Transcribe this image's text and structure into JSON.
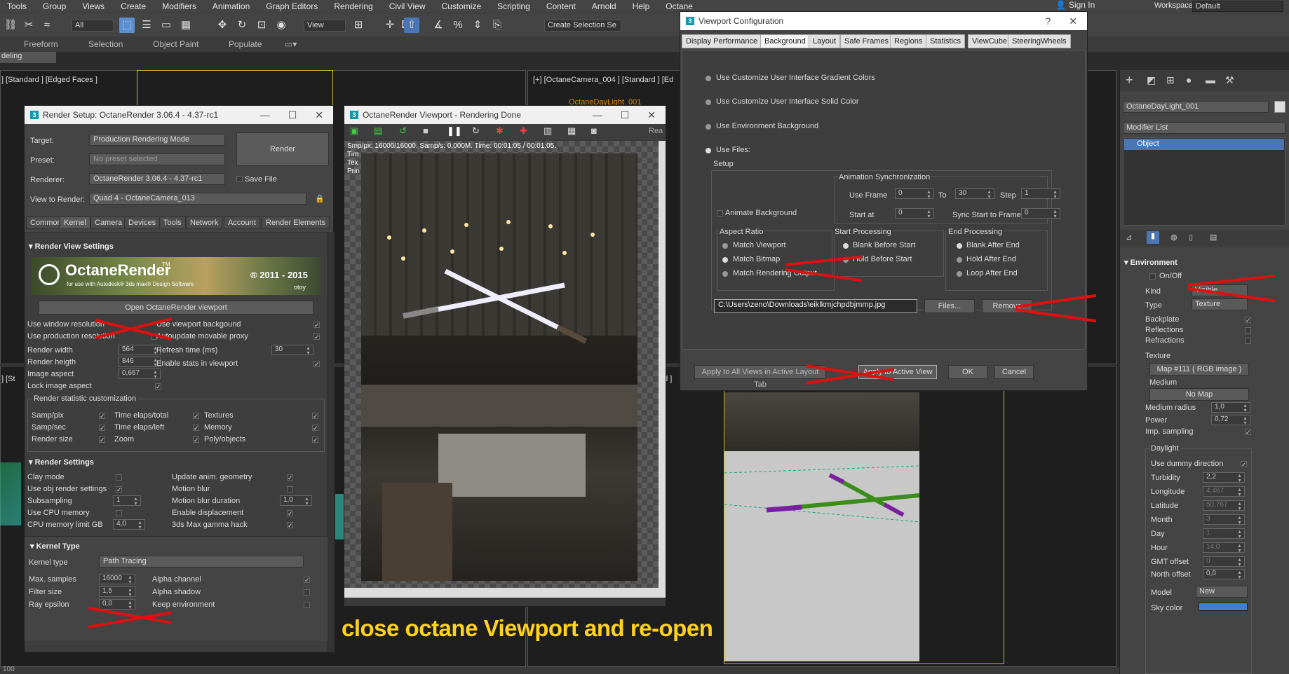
{
  "menubar": {
    "items": [
      "Tools",
      "Group",
      "Views",
      "Create",
      "Modifiers",
      "Animation",
      "Graph Editors",
      "Rendering",
      "Civil View",
      "Customize",
      "Scripting",
      "Content",
      "Arnold",
      "Help",
      "Octane"
    ],
    "sign_in": "Sign In",
    "workspaces_label": "Workspaces:",
    "workspaces_value": "Default"
  },
  "toolbar": {
    "filter_select": "All",
    "view_select": "View",
    "selection_set": "Create Selection Se"
  },
  "ribbon": {
    "items": [
      "Freeform",
      "Selection",
      "Object Paint",
      "Populate"
    ],
    "mode": "deling"
  },
  "viewports": {
    "top_left": "] [Standard ] [Edged Faces ]",
    "top_right": "[+] [OctaneCamera_004 ] [Standard ] [Ed",
    "top_right_obj": "OctaneDayLight_001",
    "bottom_left": "] [St",
    "bottom_right": "ed ]"
  },
  "render_setup": {
    "title": "Render Setup: OctaneRender 3.06.4 - 4.37-rc1",
    "target_label": "Target:",
    "target_value": "Production Rendering Mode",
    "preset_label": "Preset:",
    "preset_value": "No preset selected",
    "renderer_label": "Renderer:",
    "renderer_value": "OctaneRender 3.06.4 - 4.37-rc1",
    "save_file": "Save File",
    "view_label": "View to Render:",
    "view_value": "Quad 4 - OctaneCamera_013",
    "render_button": "Render",
    "tabs": [
      "Common",
      "Kernel",
      "Camera",
      "Devices",
      "Tools",
      "Network",
      "Account",
      "Render Elements"
    ],
    "rvs_title": "Render View Settings",
    "banner_title": "OctaneRender",
    "banner_tm": "TM",
    "banner_sub": "for use with Autodesk® 3ds max® Design Software",
    "banner_years": "® 2011 - 2015",
    "banner_brand": "otoy",
    "open_viewport": "Open OctaneRender viewport",
    "use_window_res": "Use window resolution",
    "use_viewport_bg": "Use viewport backgound",
    "use_prod_res": "Use production resolution",
    "autoupdate": "Autoupdate movable proxy",
    "render_width_label": "Render width",
    "render_width": "564",
    "refresh_label": "Refresh time (ms)",
    "refresh_value": "30",
    "render_height_label": "Render heigth",
    "render_height": "846",
    "enable_stats": "Enable stats in viewport",
    "image_aspect_label": "Image aspect",
    "image_aspect": "0,667",
    "lock_aspect": "Lock image aspect",
    "stat_title": "Render statistic customization",
    "stats": [
      "Samp/pix",
      "Time elaps/total",
      "Textures",
      "Samp/sec",
      "Time elaps/left",
      "Memory",
      "Render size",
      "Zoom",
      "Poly/objects"
    ],
    "rs_title": "Render Settings",
    "clay": "Clay mode",
    "update_anim": "Update anim. geometry",
    "use_obj": "Use obj render settings",
    "motion_blur": "Motion blur",
    "subsampling_label": "Subsampling",
    "subsampling": "1",
    "mb_duration_label": "Motion blur duration",
    "mb_duration": "1,0",
    "use_cpu": "Use CPU memory",
    "enable_disp": "Enable displacement",
    "cpu_limit_label": "CPU memory limit GB",
    "cpu_limit": "4,0",
    "gamma_hack": "3ds Max gamma hack",
    "kernel_title": "Kernel Type",
    "kernel_label": "Kernel type",
    "kernel_value": "Path Tracing",
    "max_samples_label": "Max. samples",
    "max_samples": "16000",
    "alpha_channel": "Alpha channel",
    "filter_label": "Filter size",
    "filter_value": "1,5",
    "alpha_shadow": "Alpha shadow",
    "ray_eps_label": "Ray epsilon",
    "ray_eps": "0,0",
    "keep_env": "Keep environment"
  },
  "octane_viewport": {
    "title": "OctaneRender Viewport - Rendering Done",
    "ready": "Rea",
    "stats": "Smp/px: 16000/16000.  Samp/s: 0.000M.  Time: 00:01:05 / 00:01:05.",
    "stats2": "Tim",
    "stats3": "Tex",
    "stats4": "Prin"
  },
  "viewport_config": {
    "title": "Viewport Configuration",
    "help": "?",
    "tabs": [
      "Display Performance",
      "Background",
      "Layout",
      "Safe Frames",
      "Regions",
      "Statistics",
      "ViewCube",
      "SteeringWheels"
    ],
    "opt_gradient": "Use Customize User Interface Gradient Colors",
    "opt_solid": "Use Customize User Interface Solid Color",
    "opt_env": "Use Environment Background",
    "opt_files": "Use Files:",
    "setup": "Setup",
    "anim_sync": "Animation Synchronization",
    "use_frame": "Use Frame",
    "use_frame_val": "0",
    "to": "To",
    "to_val": "30",
    "step": "Step",
    "step_val": "1",
    "animate_bg": "Animate Background",
    "start_at": "Start at",
    "start_at_val": "0",
    "sync_start": "Sync Start to Frame",
    "sync_start_val": "0",
    "aspect_ratio": "Aspect Ratio",
    "match_viewport": "Match Viewport",
    "match_bitmap": "Match Bitmap",
    "match_render": "Match Rendering Output",
    "start_processing": "Start Processing",
    "blank_before": "Blank Before Start",
    "hold_before": "Hold Before Start",
    "end_processing": "End Processing",
    "blank_after": "Blank After End",
    "hold_after": "Hold After End",
    "loop_after": "Loop After End",
    "file_path": "C:\\Users\\zeno\\Downloads\\eiklkmjchpdbjmmp.jpg",
    "files_button": "Files...",
    "remove_button": "Remove",
    "apply_all": "Apply to All Views in Active Layout Tab",
    "apply_active": "Apply to Active View",
    "ok": "OK",
    "cancel": "Cancel"
  },
  "command_panel": {
    "object_name": "OctaneDayLight_001",
    "modifier_list": "Modifier List",
    "stack_item": "Object",
    "env_title": "Environment",
    "onoff": "On/Off",
    "kind_label": "Kind",
    "kind_value": "Visible",
    "type_label": "Type",
    "type_value": "Texture",
    "backplate": "Backplate",
    "reflections": "Reflections",
    "refractions": "Refractions",
    "texture_label": "Texture",
    "texture_value": "Map #111  ( RGB image )",
    "medium_label": "Medium",
    "medium_value": "No Map",
    "medium_radius_label": "Medium radius",
    "medium_radius": "1,0",
    "power_label": "Power",
    "power": "0,72",
    "imp_sampling": "Imp. sampling",
    "daylight": "Daylight",
    "dummy_dir": "Use dummy direction",
    "turbidity_label": "Turbidity",
    "turbidity": "2,2",
    "longitude_label": "Longitude",
    "longitude": "4,467",
    "latitude_label": "Latitude",
    "latitude": "50,767",
    "month_label": "Month",
    "month": "3",
    "day_label": "Day",
    "day": "1",
    "hour_label": "Hour",
    "hour": "14,0",
    "gmt_label": "GMT offset",
    "gmt": "0",
    "north_label": "North offset",
    "north": "0,0",
    "model_label": "Model",
    "model_value": "New",
    "sky_color_label": "Sky color",
    "sky_color": "#3f7fd8"
  },
  "statusbar": {
    "coord": "100"
  },
  "caption": "close octane Viewport and re-open",
  "colors": {
    "accent_red": "#e01010",
    "caption_yellow": "#ffd21c",
    "selection_blue": "#4a76b3"
  }
}
